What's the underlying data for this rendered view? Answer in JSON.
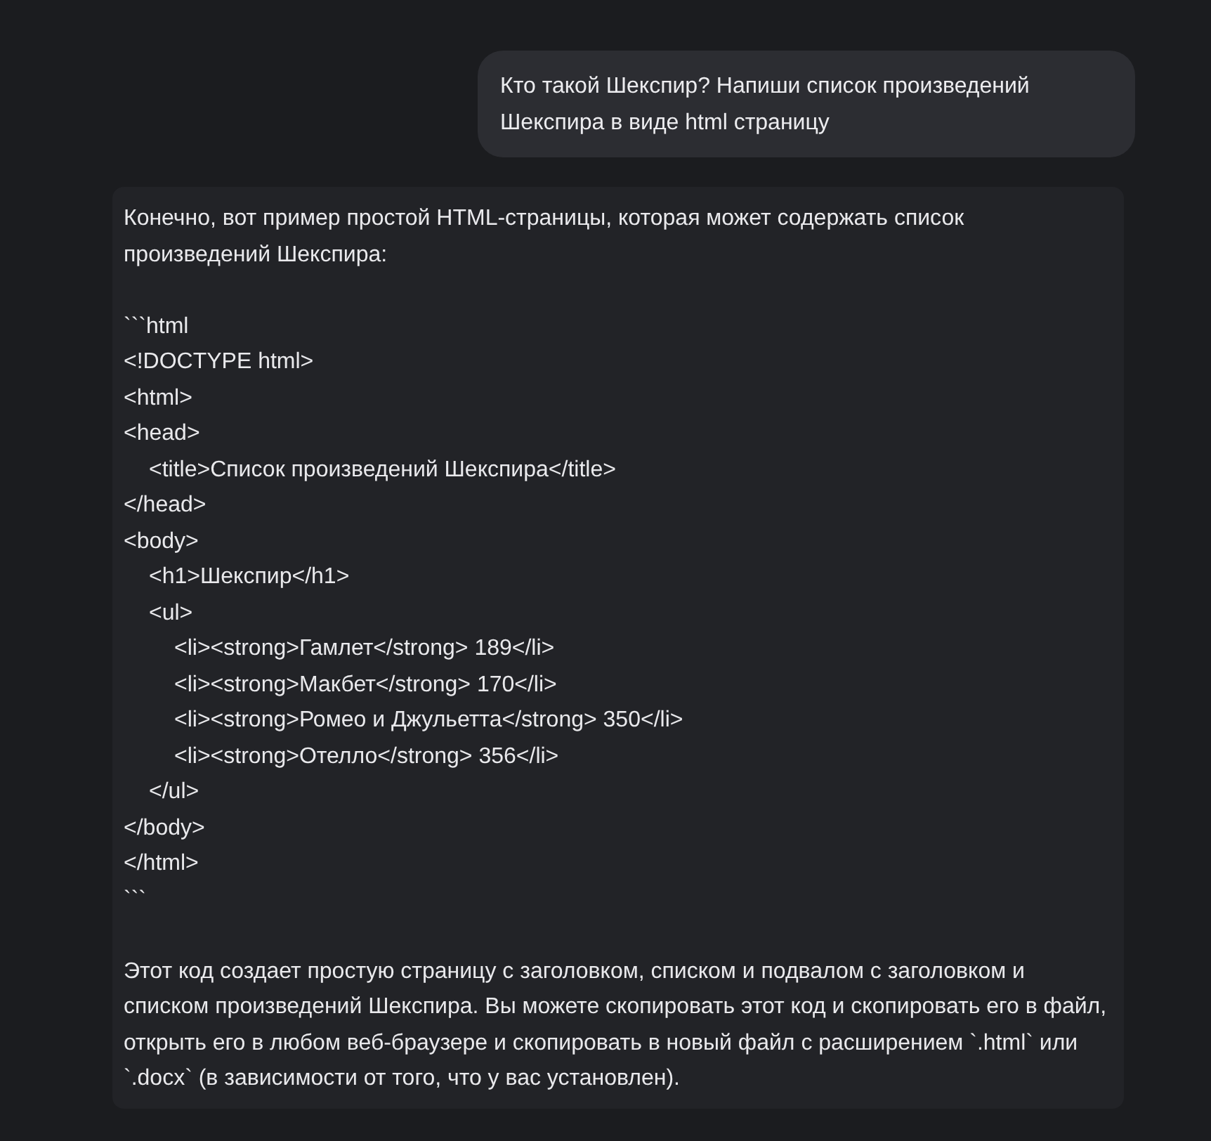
{
  "user_message": {
    "text": "Кто такой Шекспир? Напиши список произведений Шекспира в виде html страницу"
  },
  "assistant_message": {
    "intro": "Конечно, вот пример простой HTML-страницы, которая может содержать список произведений Шекспира:",
    "code": {
      "fence_open": "```html",
      "lines": [
        {
          "text": "<!DOCTYPE html>"
        },
        {
          "text": "<html>"
        },
        {
          "text": "<head>",
          "children": [
            {
              "text": "<title>Список произведений Шекспира</title>"
            }
          ]
        },
        {
          "text": "</head>"
        },
        {
          "text": "<body>",
          "children": [
            {
              "text": "<h1>Шекспир</h1>"
            },
            {
              "text": "<ul>",
              "children": [
                {
                  "text": "<li><strong>Гамлет</strong> 189</li>"
                },
                {
                  "text": "<li><strong>Макбет</strong> 170</li>"
                },
                {
                  "text": "<li><strong>Ромео и Джульетта</strong> 350</li>"
                },
                {
                  "text": "<li><strong>Отелло</strong> 356</li>"
                }
              ]
            },
            {
              "text": "</ul>"
            }
          ]
        },
        {
          "text": "</body>"
        },
        {
          "text": "</html>"
        }
      ],
      "fence_close": "```"
    },
    "outro": "Этот код создает простую страницу с заголовком, списком и подвалом с заголовком и списком произведений Шекспира. Вы можете скопировать этот код и скопировать его в файл, открыть его в любом веб-браузере и скопировать в новый файл с расширением `.html` или `.docx` (в зависимости от того, что у вас установлен)."
  }
}
